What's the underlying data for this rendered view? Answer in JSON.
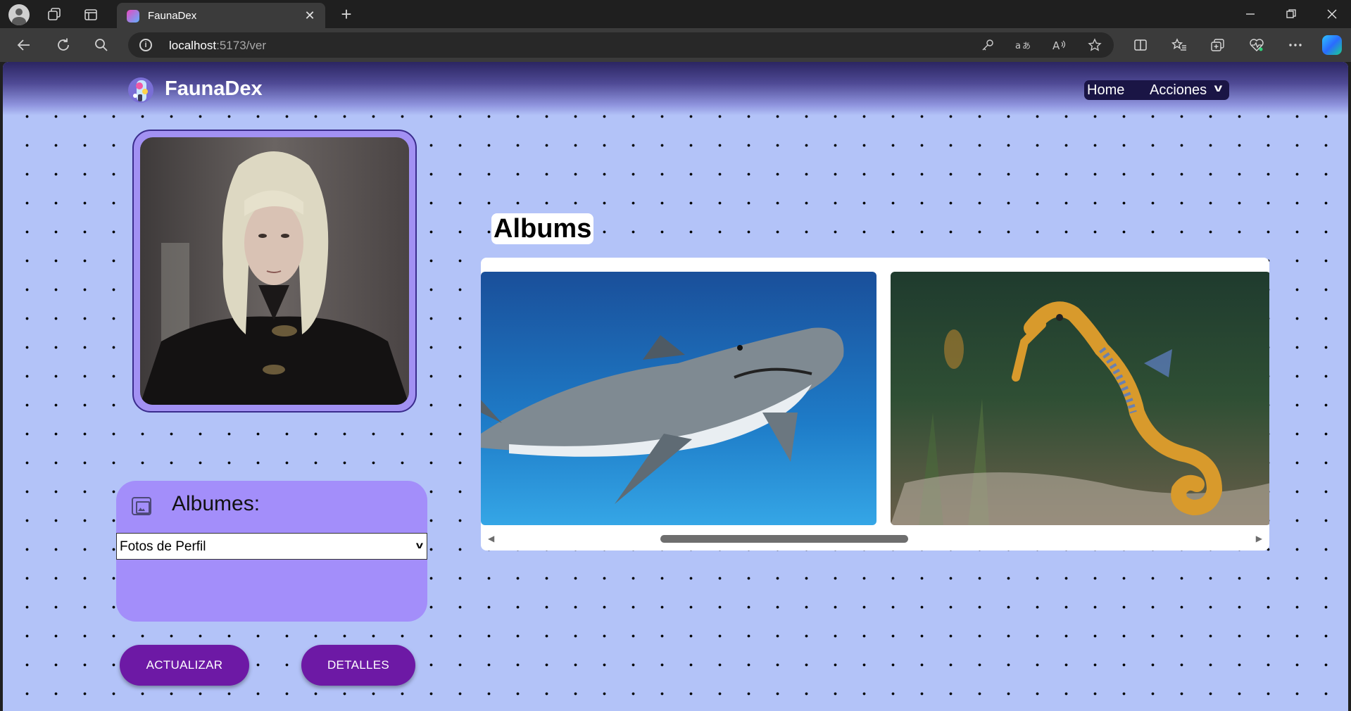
{
  "browser": {
    "tab_title": "FaunaDex",
    "tab_close": "✕",
    "new_tab": "+",
    "url_host": "localhost",
    "url_path": ":5173/ver",
    "icons": [
      "profile-icon",
      "workspaces-icon",
      "tab-actions-icon",
      "back-icon",
      "refresh-icon",
      "search-icon",
      "site-info-icon",
      "key-icon",
      "translate-icon",
      "read-aloud-icon",
      "favorite-star-icon",
      "split-screen-icon",
      "favorites-icon",
      "collections-icon",
      "health-icon",
      "more-icon",
      "copilot-icon"
    ]
  },
  "header": {
    "brand": "FaunaDex",
    "nav_home": "Home",
    "nav_acciones": "Acciones",
    "nav_chevron": "v"
  },
  "sidebar": {
    "albums_label": "Albumes:",
    "select_value": "Fotos de Perfil",
    "select_chevron": "v",
    "update_button": "ACTUALIZAR",
    "details_button": "DETALLES"
  },
  "gallery": {
    "heading": "Albums",
    "scroll_left": "◀",
    "scroll_right": "▶"
  },
  "colors": {
    "page_bg": "#b3c3f8",
    "accent_purple": "#6d19a5",
    "panel_purple": "#a38efa",
    "nav_bg": "#1a1545"
  }
}
